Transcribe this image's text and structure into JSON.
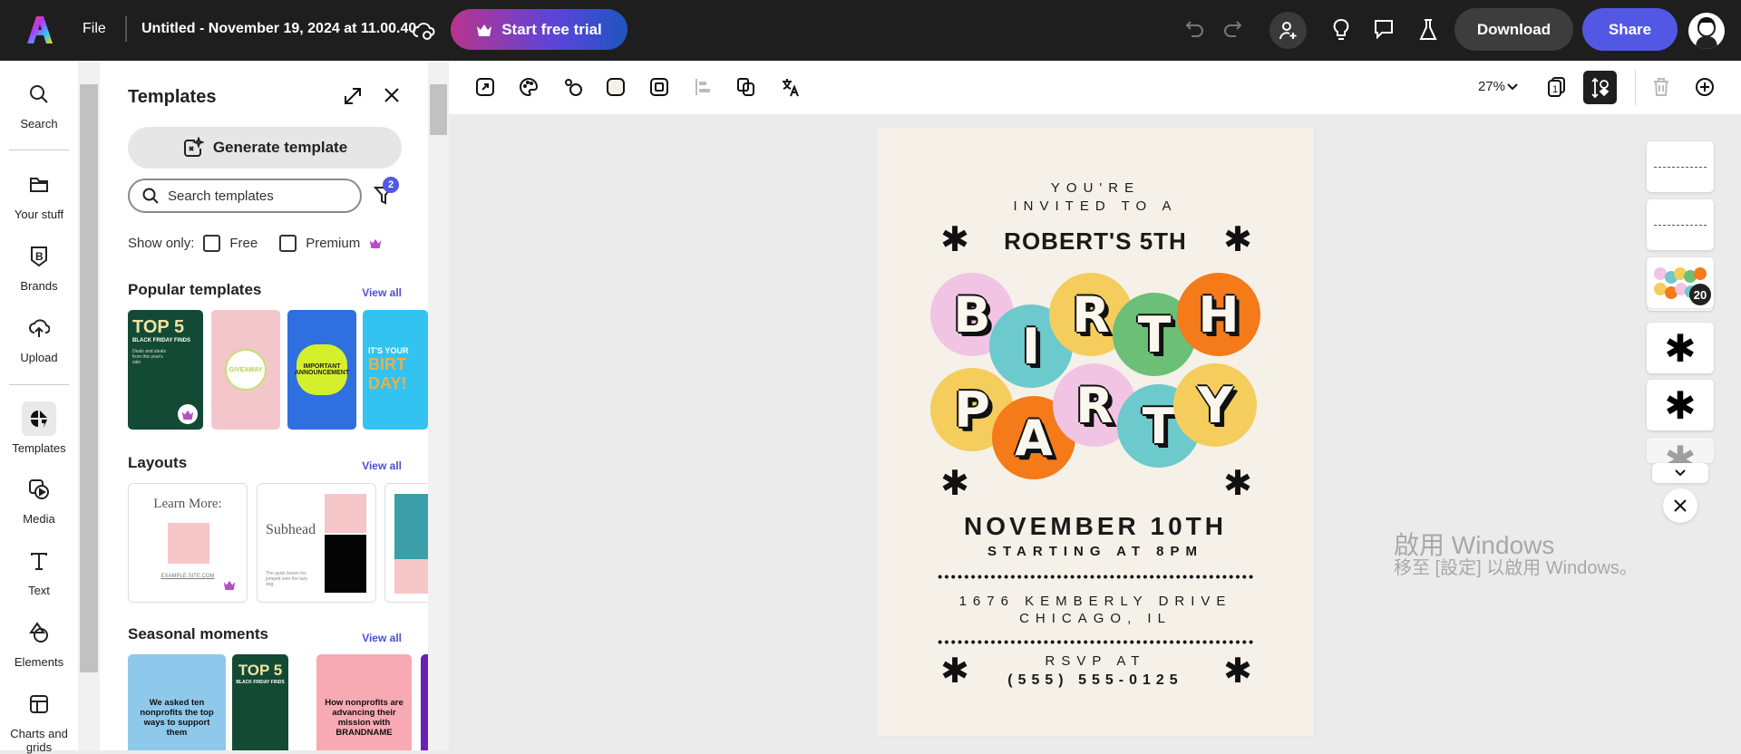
{
  "topbar": {
    "file": "File",
    "doc_title": "Untitled - November 19, 2024 at 11.00.40",
    "trial": "Start free trial",
    "download": "Download",
    "share": "Share"
  },
  "rail": {
    "items": [
      {
        "label": "Search"
      },
      {
        "label": "Your stuff"
      },
      {
        "label": "Brands"
      },
      {
        "label": "Upload"
      },
      {
        "label": "Templates",
        "selected": true
      },
      {
        "label": "Media"
      },
      {
        "label": "Text"
      },
      {
        "label": "Elements"
      },
      {
        "label": "Charts and grids"
      }
    ]
  },
  "panel": {
    "title": "Templates",
    "generate": "Generate template",
    "search_placeholder": "Search templates",
    "filter_count": "2",
    "show_only": "Show only:",
    "free": "Free",
    "premium": "Premium",
    "sections": [
      {
        "title": "Popular templates",
        "view_all": "View all"
      },
      {
        "title": "Layouts",
        "view_all": "View all"
      },
      {
        "title": "Seasonal moments",
        "view_all": "View all"
      }
    ],
    "popular": [
      {
        "line1": "TOP 5",
        "line2": "BLACK FRIDAY FINDS",
        "line3": "Deals and steals from this year's sale"
      },
      {
        "line1": "GIVEAWAY"
      },
      {
        "line1": "IMPORTANT ANNOUNCEMENT"
      },
      {
        "line1": "IT'S YOUR",
        "line2": "BIRT DAY!"
      }
    ],
    "layouts": [
      {
        "title": "Learn More:",
        "footer": "EXAMPLE.SITE.COM"
      },
      {
        "title": "Subhead",
        "body": "The quick brown fox jumped over the lazy dog."
      }
    ],
    "seasonal": [
      {
        "text": "We asked ten nonprofits the top ways to support them"
      },
      {
        "line1": "TOP 5",
        "line2": "BLACK FRIDAY FINDS"
      },
      {
        "text": "How nonprofits are advancing their mission with BRANDNAME"
      }
    ]
  },
  "toolbar": {
    "zoom": "27%",
    "page_count": "1"
  },
  "invite": {
    "youre": "YOU'RE",
    "invited": "INVITED TO A",
    "name": "ROBERT'S 5TH",
    "balloons": [
      {
        "letter": "B",
        "color": "#f2c4e4"
      },
      {
        "letter": "I",
        "color": "#6cc9cc"
      },
      {
        "letter": "R",
        "color": "#f5cd5c"
      },
      {
        "letter": "T",
        "color": "#6cbf77"
      },
      {
        "letter": "H",
        "color": "#f47a1a"
      },
      {
        "letter": "P",
        "color": "#f5cd5c"
      },
      {
        "letter": "A",
        "color": "#f47a1a"
      },
      {
        "letter": "R",
        "color": "#f2c4e4"
      },
      {
        "letter": "T",
        "color": "#6cc9cc"
      },
      {
        "letter": "Y",
        "color": "#f5cd5c"
      }
    ],
    "date": "NOVEMBER 10TH",
    "time": "STARTING AT 8PM",
    "address1": "1676 KEMBERLY DRIVE",
    "address2": "CHICAGO, IL",
    "rsvp": "RSVP AT",
    "phone": "(555) 555-0125"
  },
  "layers": {
    "group_count": "20"
  },
  "watermark": {
    "line1": "啟用 Windows",
    "line2": "移至 [設定] 以啟用 Windows。"
  }
}
